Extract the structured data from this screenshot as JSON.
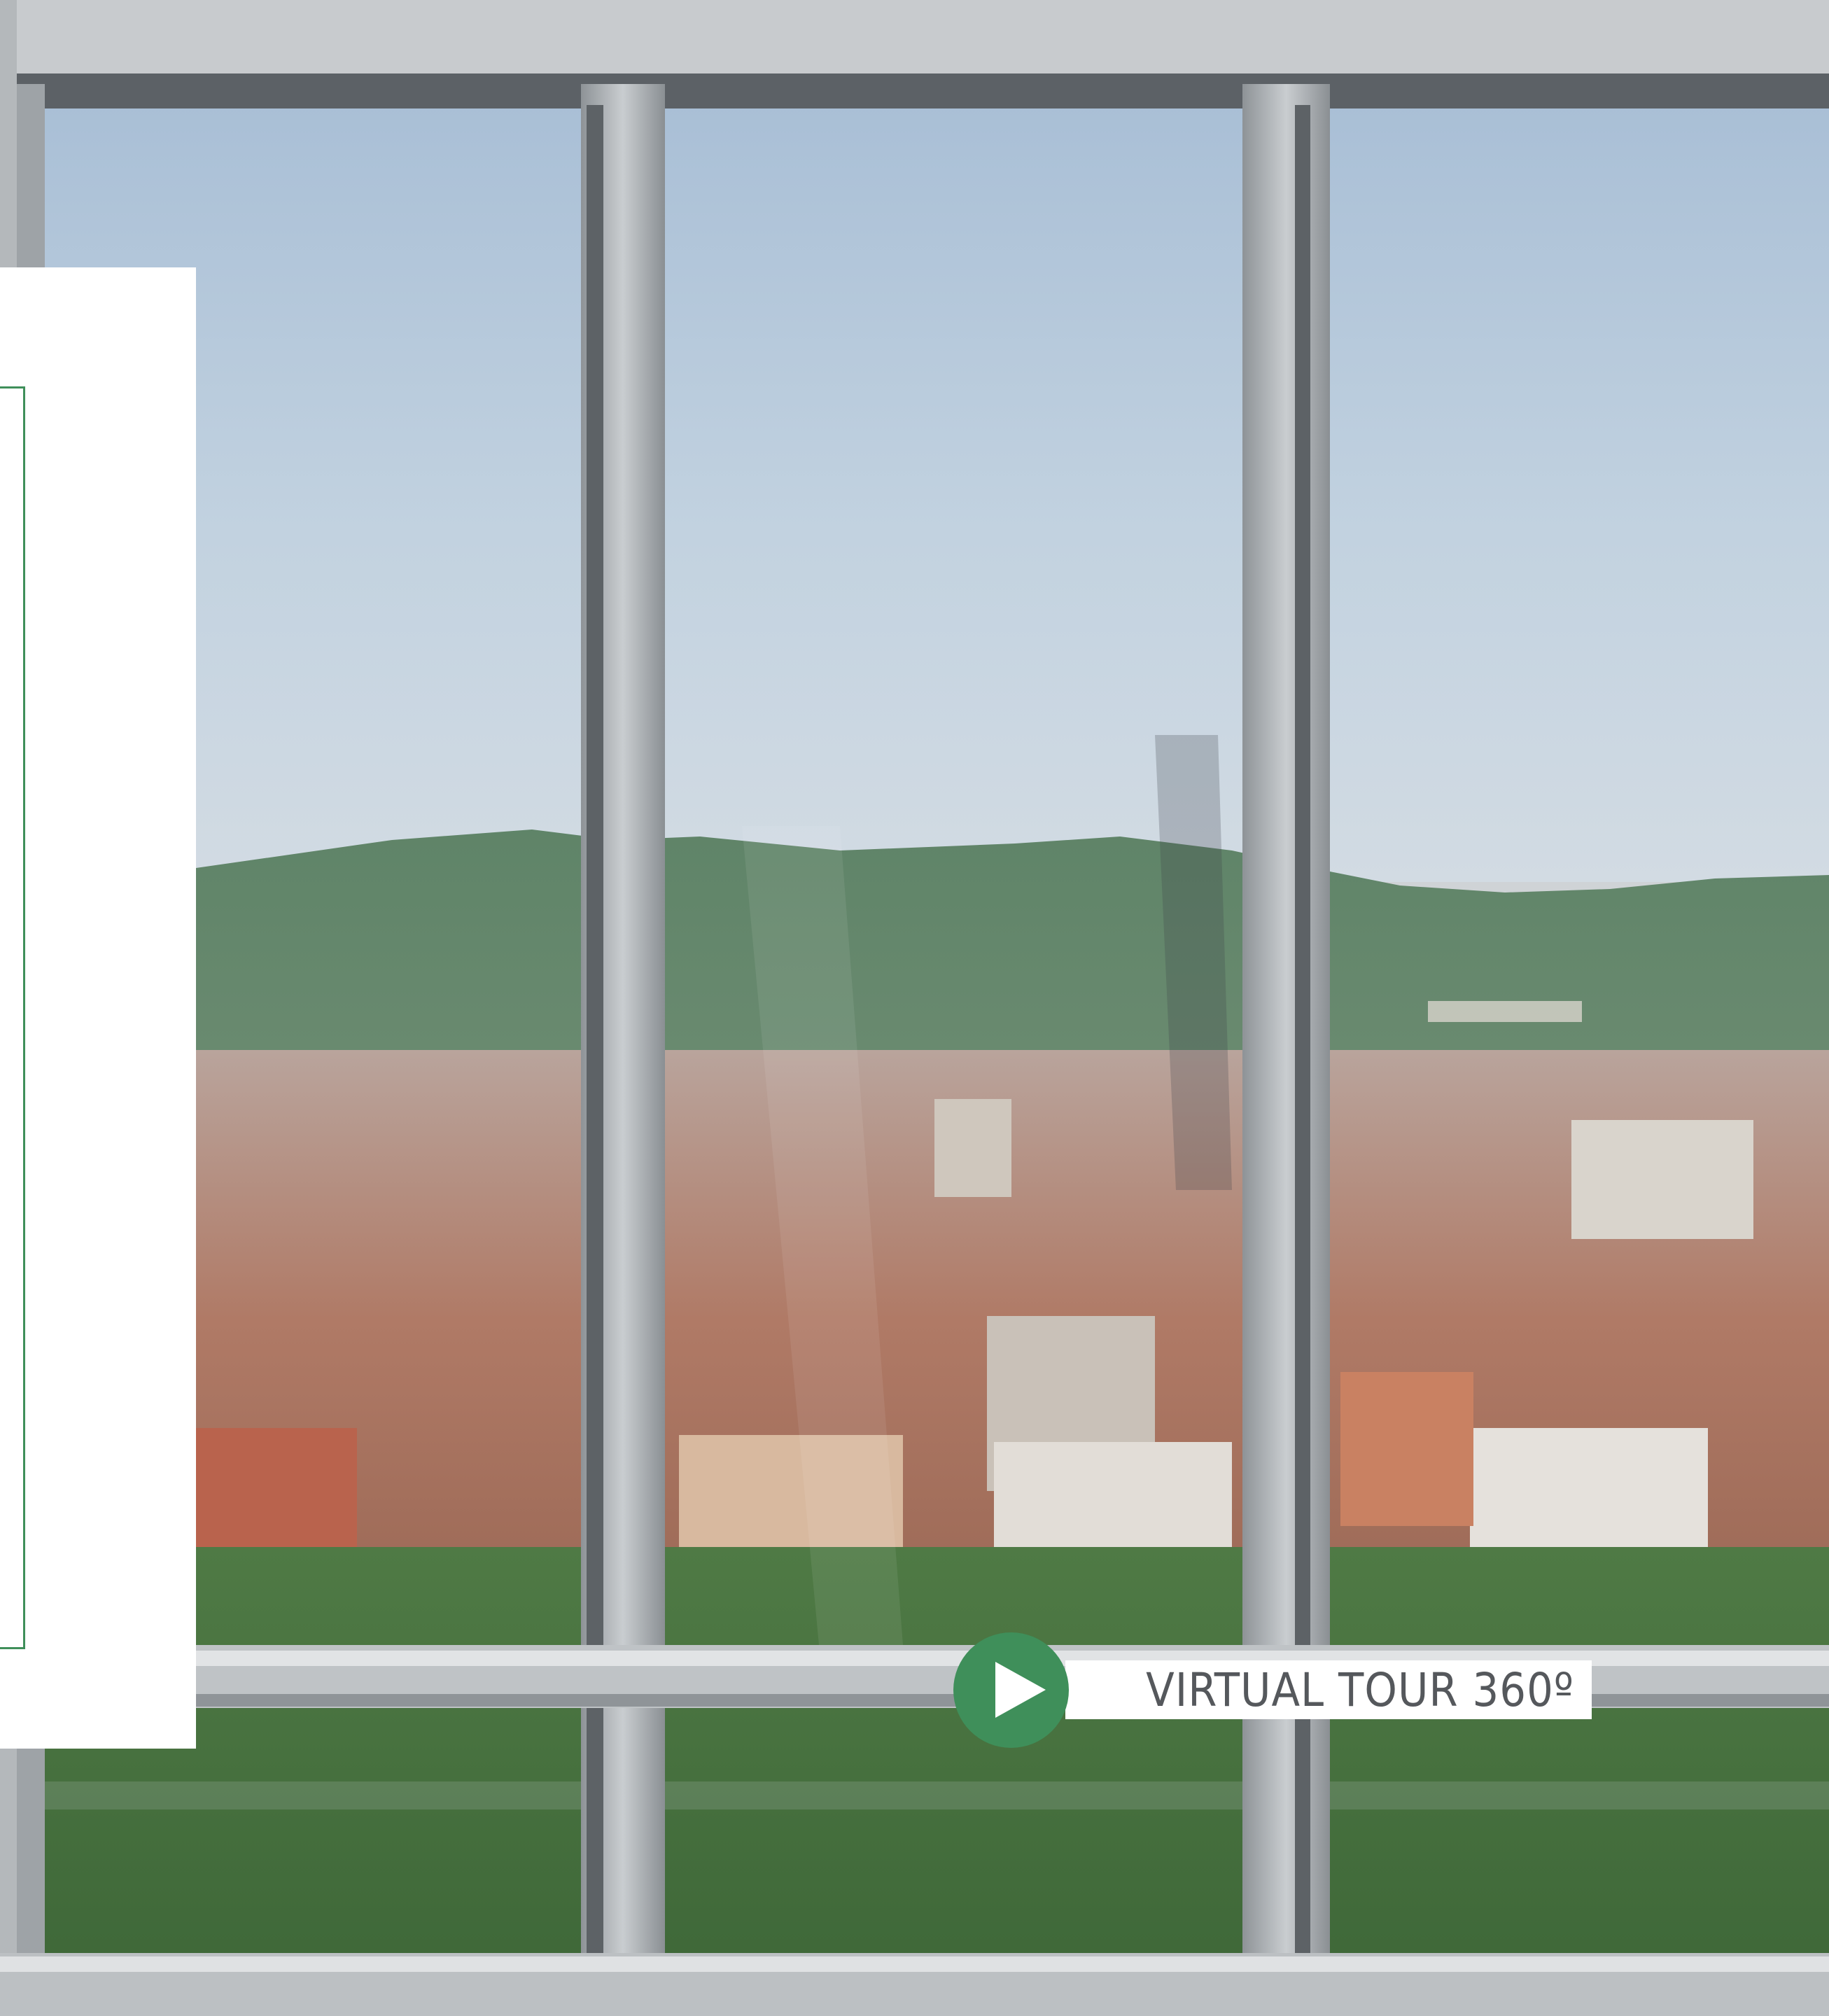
{
  "tour": {
    "label": "VIRTUAL TOUR 360º",
    "icon": "play-icon",
    "accent_color": "#3f8f5a"
  },
  "photo": {
    "icon": "photo-window-view"
  }
}
